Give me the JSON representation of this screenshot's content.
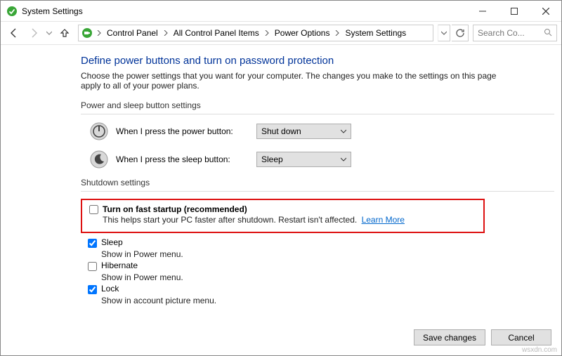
{
  "window": {
    "title": "System Settings"
  },
  "breadcrumb": {
    "items": [
      "Control Panel",
      "All Control Panel Items",
      "Power Options",
      "System Settings"
    ]
  },
  "search": {
    "placeholder": "Search Co..."
  },
  "page": {
    "title": "Define power buttons and turn on password protection",
    "subtitle": "Choose the power settings that you want for your computer. The changes you make to the settings on this page apply to all of your power plans."
  },
  "section_power": {
    "heading": "Power and sleep button settings",
    "power_label": "When I press the power button:",
    "power_value": "Shut down",
    "sleep_label": "When I press the sleep button:",
    "sleep_value": "Sleep"
  },
  "section_shutdown": {
    "heading": "Shutdown settings",
    "fast_startup": {
      "checked": false,
      "title": "Turn on fast startup (recommended)",
      "desc": "This helps start your PC faster after shutdown. Restart isn't affected.",
      "learn_more": "Learn More"
    },
    "sleep": {
      "checked": true,
      "title": "Sleep",
      "desc": "Show in Power menu."
    },
    "hibernate": {
      "checked": false,
      "title": "Hibernate",
      "desc": "Show in Power menu."
    },
    "lock": {
      "checked": true,
      "title": "Lock",
      "desc": "Show in account picture menu."
    }
  },
  "buttons": {
    "save": "Save changes",
    "cancel": "Cancel"
  },
  "watermark": "wsxdn.com"
}
